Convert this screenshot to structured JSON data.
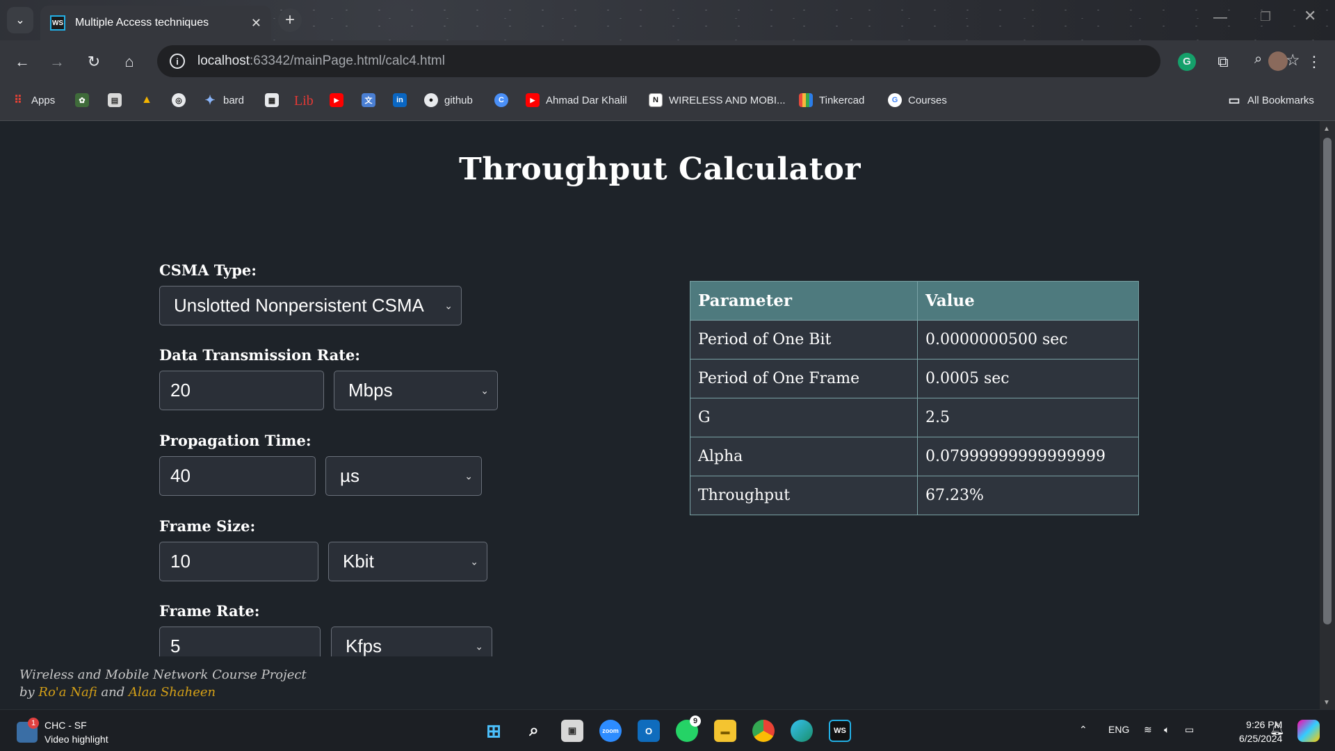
{
  "browser": {
    "tab_title": "Multiple Access techniques",
    "tab_close": "✕",
    "new_tab": "+",
    "url_host": "localhost",
    "url_path": ":63342/mainPage.html/calc4.html"
  },
  "bookmarks": [
    {
      "label": "Apps",
      "icon": "apps-grid-icon"
    },
    {
      "label": "",
      "icon": "tree-icon"
    },
    {
      "label": "",
      "icon": "document-icon"
    },
    {
      "label": "",
      "icon": "google-drive-icon"
    },
    {
      "label": "",
      "icon": "chatgpt-icon"
    },
    {
      "label": "bard",
      "icon": "bard-icon"
    },
    {
      "label": "",
      "icon": "qr-icon"
    },
    {
      "label": "Lib",
      "icon": "lib-icon"
    },
    {
      "label": "",
      "icon": "youtube-icon"
    },
    {
      "label": "",
      "icon": "translate-icon"
    },
    {
      "label": "",
      "icon": "linkedin-icon"
    },
    {
      "label": "github",
      "icon": "github-icon"
    },
    {
      "label": "",
      "icon": "canva-icon"
    },
    {
      "label": "Ahmad Dar Khalil",
      "icon": "youtube-icon"
    },
    {
      "label": "WIRELESS AND MOBI...",
      "icon": "notion-icon"
    },
    {
      "label": "Tinkercad",
      "icon": "tinkercad-icon"
    },
    {
      "label": "Courses",
      "icon": "google-icon"
    },
    {
      "label": "All Bookmarks",
      "icon": "folder-icon"
    }
  ],
  "page": {
    "title": "Throughput Calculator",
    "csma_label": "CSMA Type:",
    "csma_value": "Unslotted Nonpersistent CSMA",
    "rate_label": "Data Transmission Rate:",
    "rate_value": "20",
    "rate_unit": "Mbps",
    "prop_label": "Propagation Time:",
    "prop_value": "40",
    "prop_unit": "µs",
    "frame_size_label": "Frame Size:",
    "frame_size_value": "10",
    "frame_size_unit": "Kbit",
    "frame_rate_label": "Frame Rate:",
    "frame_rate_value": "5",
    "frame_rate_unit": "Kfps"
  },
  "results": {
    "headers": [
      "Parameter",
      "Value"
    ],
    "rows": [
      [
        "Period of One Bit",
        "0.0000000500 sec"
      ],
      [
        "Period of One Frame",
        "0.0005 sec"
      ],
      [
        "G",
        "2.5"
      ],
      [
        "Alpha",
        "0.07999999999999999"
      ],
      [
        "Throughput",
        "67.23%"
      ]
    ]
  },
  "footer": {
    "line1": "Wireless and Mobile Network Course Project",
    "by": "by ",
    "author1": "Ro'a Nafi",
    "and": " and ",
    "author2": "Alaa Shaheen"
  },
  "taskbar": {
    "news_badge": "1",
    "news_title": "CHC - SF",
    "news_sub": "Video highlight",
    "whatsapp_badge": "9",
    "lang": "ENG",
    "time": "9:26 PM",
    "date": "6/25/2024"
  },
  "colors": {
    "page_bg": "#1e2329",
    "header_teal": "#4e7a7e",
    "author_gold": "#d4a017"
  }
}
